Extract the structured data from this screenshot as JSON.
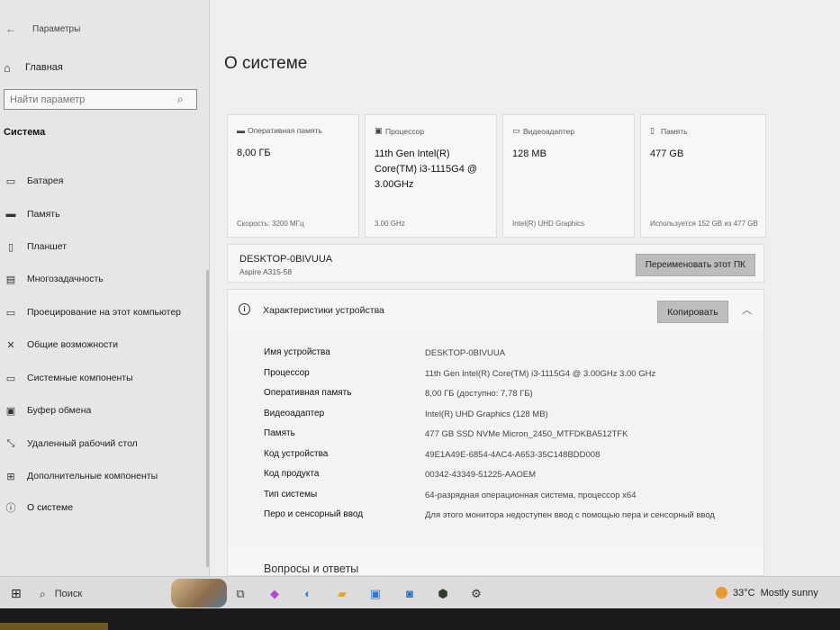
{
  "window": {
    "title": "Параметры"
  },
  "sidebar": {
    "home_label": "Главная",
    "search_placeholder": "Найти параметр",
    "section": "Система",
    "items": [
      {
        "label": "Батарея",
        "icon": "battery-icon"
      },
      {
        "label": "Память",
        "icon": "storage-icon"
      },
      {
        "label": "Планшет",
        "icon": "tablet-icon"
      },
      {
        "label": "Многозадачность",
        "icon": "multitasking-icon"
      },
      {
        "label": "Проецирование на этот компьютер",
        "icon": "projecting-icon"
      },
      {
        "label": "Общие возможности",
        "icon": "shared-experiences-icon"
      },
      {
        "label": "Системные компоненты",
        "icon": "system-components-icon"
      },
      {
        "label": "Буфер обмена",
        "icon": "clipboard-icon"
      },
      {
        "label": "Удаленный рабочий стол",
        "icon": "remote-desktop-icon"
      },
      {
        "label": "Дополнительные компоненты",
        "icon": "optional-features-icon"
      },
      {
        "label": "О системе",
        "icon": "about-icon"
      }
    ]
  },
  "main": {
    "title": "О системе",
    "cards": [
      {
        "icon": "ram-icon",
        "title": "Оперативная память",
        "value": "8,00 ГБ",
        "foot": "Скорость: 3200 МГц"
      },
      {
        "icon": "cpu-icon",
        "title": "Процессор",
        "value": "11th Gen Intel(R) Core(TM) i3-1115G4 @ 3.00GHz",
        "foot": "3.00 GHz"
      },
      {
        "icon": "gpu-icon",
        "title": "Видеоадаптер",
        "value": "128 MB",
        "foot": "Intel(R) UHD Graphics"
      },
      {
        "icon": "disk-icon",
        "title": "Память",
        "value": "477 GB",
        "foot": "Используется 152 GB из 477 GB"
      }
    ],
    "device": {
      "name": "DESKTOP-0BIVUUA",
      "model": "Aspire A315-58",
      "rename_label": "Переименовать этот ПК"
    },
    "specs": {
      "title": "Характеристики устройства",
      "copy_label": "Копировать",
      "rows": [
        {
          "k": "Имя устройства",
          "v": "DESKTOP-0BIVUUA"
        },
        {
          "k": "Процессор",
          "v": "11th Gen Intel(R) Core(TM) i3-1115G4 @ 3.00GHz   3.00 GHz"
        },
        {
          "k": "Оперативная память",
          "v": "8,00 ГБ (доступно: 7,78 ГБ)"
        },
        {
          "k": "Видеоадаптер",
          "v": "Intel(R) UHD Graphics (128 MB)"
        },
        {
          "k": "Память",
          "v": "477 GB SSD NVMe Micron_2450_MTFDKBA512TFK"
        },
        {
          "k": "Код устройства",
          "v": "49E1A49E-6854-4AC4-A653-35C148BDD008"
        },
        {
          "k": "Код продукта",
          "v": "00342-43349-51225-AAOEM"
        },
        {
          "k": "Тип системы",
          "v": "64-разрядная операционная система, процессор x64"
        },
        {
          "k": "Перо и сенсорный ввод",
          "v": "Для этого монитора недоступен ввод с помощью пера и сенсорный ввод"
        }
      ],
      "faq": "Вопросы и ответы"
    }
  },
  "taskbar": {
    "search_label": "Поиск",
    "weather_temp": "33°C",
    "weather_desc": "Mostly sunny",
    "apps": [
      "task-view-icon",
      "copilot-icon",
      "edge-icon",
      "file-explorer-icon",
      "store-icon",
      "outlook-icon",
      "app-icon",
      "settings-icon"
    ]
  }
}
